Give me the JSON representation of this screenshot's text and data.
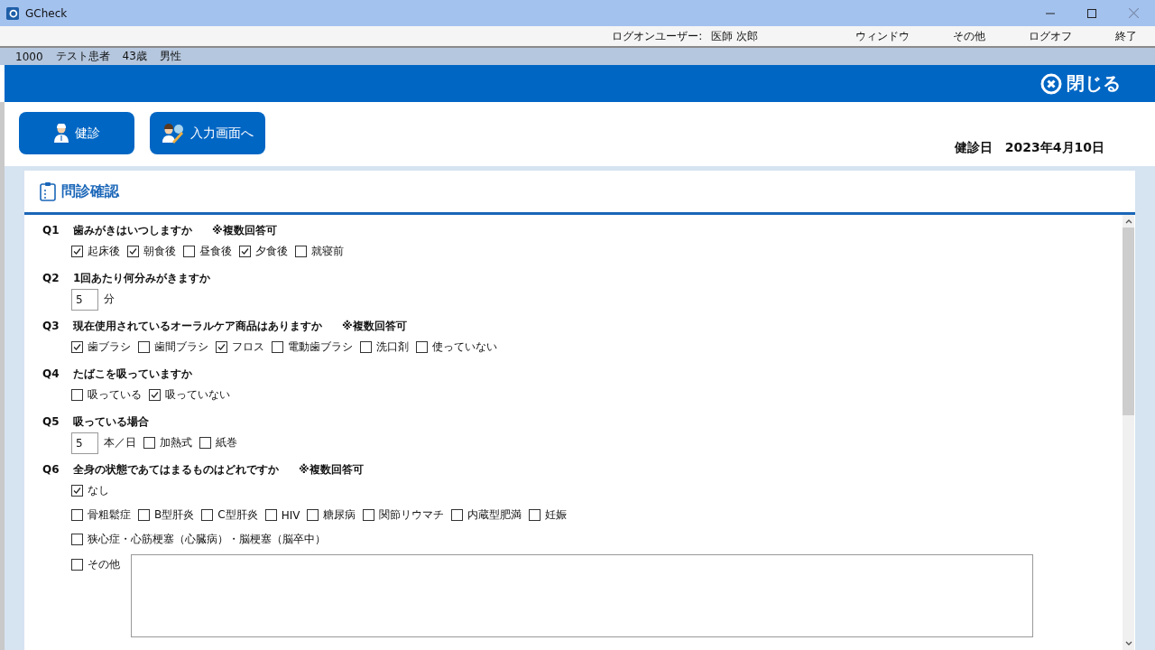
{
  "window": {
    "title": "GCheck"
  },
  "menu_bar": {
    "user_label": "ログオンユーザー:",
    "user_name": "医師 次郎",
    "items": [
      "ウィンドウ",
      "その他",
      "ログオフ",
      "終了"
    ]
  },
  "patient_bar": [
    "1000",
    "テスト患者",
    "43歳",
    "男性"
  ],
  "header": {
    "close_button": "閉じる"
  },
  "toolbar": {
    "buttons": [
      {
        "kind": "doctor",
        "label": "健診"
      },
      {
        "kind": "doctor_pen",
        "label": "入力画面へ"
      }
    ],
    "date_label": "健診日",
    "date": "2023年4月10日"
  },
  "panel": {
    "title": "問診確認",
    "questions": [
      {
        "number": "Q1",
        "text": "歯みがきはいつしますか",
        "note": "※複数回答可",
        "rows": [
          [
            {
              "kind": "checkbox",
              "label": "起床後",
              "checked": true
            },
            {
              "kind": "checkbox",
              "label": "朝食後",
              "checked": true
            },
            {
              "kind": "checkbox",
              "label": "昼食後",
              "checked": false
            },
            {
              "kind": "checkbox",
              "label": "夕食後",
              "checked": true
            },
            {
              "kind": "checkbox",
              "label": "就寝前",
              "checked": false
            }
          ]
        ]
      },
      {
        "number": "Q2",
        "text": "1回あたり何分みがきますか",
        "rows": [
          [
            {
              "kind": "number",
              "value": "5",
              "unit": "分"
            }
          ]
        ]
      },
      {
        "number": "Q3",
        "text": "現在使用されているオーラルケア商品はありますか",
        "note": "※複数回答可",
        "rows": [
          [
            {
              "kind": "checkbox",
              "label": "歯ブラシ",
              "checked": true
            },
            {
              "kind": "checkbox",
              "label": "歯間ブラシ",
              "checked": false
            },
            {
              "kind": "checkbox",
              "label": "フロス",
              "checked": true
            },
            {
              "kind": "checkbox",
              "label": "電動歯ブラシ",
              "checked": false
            },
            {
              "kind": "checkbox",
              "label": "洗口剤",
              "checked": false
            },
            {
              "kind": "checkbox",
              "label": "使っていない",
              "checked": false
            }
          ]
        ]
      },
      {
        "number": "Q4",
        "text": "たばこを吸っていますか",
        "rows": [
          [
            {
              "kind": "checkbox",
              "label": "吸っている",
              "checked": false
            },
            {
              "kind": "checkbox",
              "label": "吸っていない",
              "checked": true
            }
          ]
        ]
      },
      {
        "number": "Q5",
        "text": "吸っている場合",
        "rows": [
          [
            {
              "kind": "number",
              "value": "5",
              "unit": "本／日"
            },
            {
              "kind": "checkbox",
              "label": "加熱式",
              "checked": false
            },
            {
              "kind": "checkbox",
              "label": "紙巻",
              "checked": false
            }
          ]
        ]
      },
      {
        "number": "Q6",
        "text": "全身の状態であてはまるものはどれですか",
        "note": "※複数回答可",
        "rows": [
          [
            {
              "kind": "checkbox",
              "label": "なし",
              "checked": true
            }
          ],
          [
            {
              "kind": "checkbox",
              "label": "骨粗鬆症",
              "checked": false
            },
            {
              "kind": "checkbox",
              "label": "B型肝炎",
              "checked": false
            },
            {
              "kind": "checkbox",
              "label": "C型肝炎",
              "checked": false
            },
            {
              "kind": "checkbox",
              "label": "HIV",
              "checked": false
            },
            {
              "kind": "checkbox",
              "label": "糖尿病",
              "checked": false
            },
            {
              "kind": "checkbox",
              "label": "関節リウマチ",
              "checked": false
            },
            {
              "kind": "checkbox",
              "label": "内蔵型肥満",
              "checked": false
            },
            {
              "kind": "checkbox",
              "label": "妊娠",
              "checked": false
            }
          ],
          [
            {
              "kind": "checkbox",
              "label": "狭心症・心筋梗塞（心臓病）・脳梗塞（脳卒中）",
              "checked": false
            }
          ],
          [
            {
              "kind": "checkbox",
              "label": "その他",
              "checked": false
            },
            {
              "kind": "textarea"
            }
          ]
        ]
      }
    ]
  }
}
